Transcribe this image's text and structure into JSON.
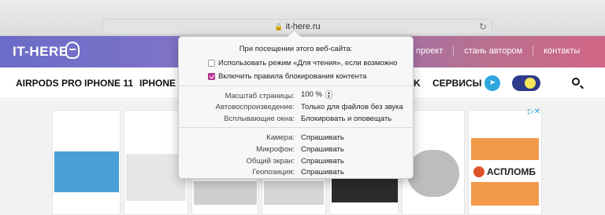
{
  "browser": {
    "url": "it-here.ru"
  },
  "site": {
    "logo": "IT-HERE",
    "top_nav": [
      "проект",
      "стань автором",
      "контакты"
    ],
    "categories": [
      "AIRPODS PRO",
      "IPHONE 11",
      "IPHONE SE",
      "K",
      "СЕРВИСЫ"
    ]
  },
  "ad": {
    "brand": "АСПЛОМБ"
  },
  "popover": {
    "title": "При посещении этого веб-сайта:",
    "reader_mode": {
      "label": "Использовать режим «Для чтения», если возможно",
      "checked": false
    },
    "content_blockers": {
      "label": "Включить правила блокирования контента",
      "checked": true
    },
    "settings": [
      {
        "label": "Масштаб страницы:",
        "value": "100 %"
      },
      {
        "label": "Автовоспроизведение:",
        "value": "Только для файлов без звука"
      },
      {
        "label": "Всплывающие окна:",
        "value": "Блокировать и оповещать"
      }
    ],
    "permissions": [
      {
        "label": "Камера:",
        "value": "Спрашивать"
      },
      {
        "label": "Микрофон:",
        "value": "Спрашивать"
      },
      {
        "label": "Общий экран:",
        "value": "Спрашивать"
      },
      {
        "label": "Геопозиция:",
        "value": "Спрашивать"
      }
    ]
  },
  "colors": {
    "header_start": "#6a6cc8",
    "header_end": "#d16585",
    "checkbox_on": "#c03f9a",
    "telegram": "#2ea6dc"
  },
  "icons": [
    "lock-icon",
    "reload-icon",
    "logo-mark-icon",
    "telegram-icon",
    "theme-toggle-icon",
    "search-icon",
    "ad-choices-icon",
    "stepper-icon"
  ]
}
